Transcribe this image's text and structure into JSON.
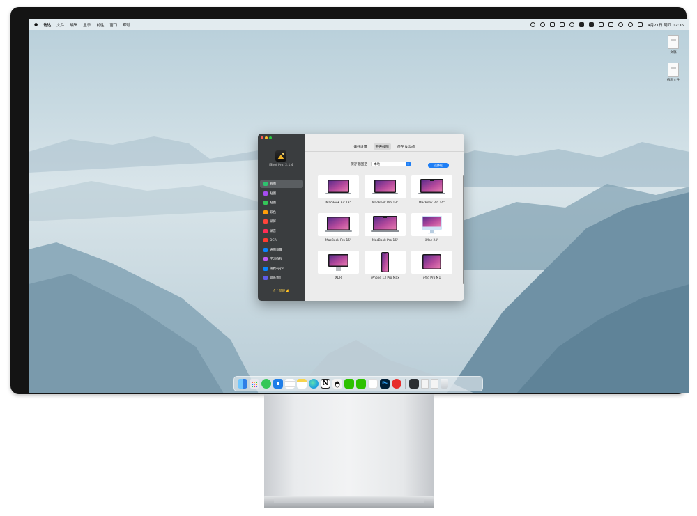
{
  "menubar": {
    "app_name": "访达",
    "menus": [
      "文件",
      "编辑",
      "显示",
      "前往",
      "窗口",
      "帮助"
    ],
    "datetime": "4月21日 周四 02:36"
  },
  "desktop_files": [
    "文稿",
    "截图文件"
  ],
  "app": {
    "version": "iShot Pro: 2.1.4",
    "nav": [
      {
        "label": "截图",
        "color": "#2ec36f",
        "active": true
      },
      {
        "label": "贴图",
        "color": "#a64df2"
      },
      {
        "label": "贴图",
        "color": "#34c759"
      },
      {
        "label": "取色",
        "color": "#ff9f0a"
      },
      {
        "label": "录屏",
        "color": "#ff453a"
      },
      {
        "label": "录音",
        "color": "#ff2d55"
      },
      {
        "label": "OCR",
        "color": "#ff3b30"
      },
      {
        "label": "通用设置",
        "color": "#0a84ff"
      },
      {
        "label": "学习教程",
        "color": "#bf5af2"
      },
      {
        "label": "免费Apps",
        "color": "#0a84ff"
      },
      {
        "label": "联系我们",
        "color": "#5e5ce6"
      }
    ],
    "like_text": "点个赞吧 👍",
    "tabs": [
      "偏好设置",
      "带壳截图",
      "保存 & 动作"
    ],
    "selected_tab": 1,
    "save_label": "保存截图至",
    "save_value": "本地",
    "choose_button": "选择框",
    "devices": [
      "MacBook Air 13\"",
      "MacBook Pro 13\"",
      "MacBook Pro 14\"",
      "MacBook Pro 15\"",
      "MacBook Pro 16\"",
      "iMac 24\"",
      "XDR",
      "iPhone 13 Pro Max",
      "iPad Pro M1"
    ]
  },
  "dock": {
    "apps": [
      {
        "name": "finder-icon",
        "color": "#3a95f5"
      },
      {
        "name": "launchpad-icon",
        "color": "#e9e9ee"
      },
      {
        "name": "messages-icon",
        "color": "#36c759"
      },
      {
        "name": "safari-icon",
        "color": "#1f7ee8"
      },
      {
        "name": "reminders-icon",
        "color": "#ffffff"
      },
      {
        "name": "notes-icon",
        "color": "#f7d44c"
      },
      {
        "name": "edge-icon",
        "color": "#1b9de2"
      },
      {
        "name": "notion-icon",
        "color": "#ffffff"
      },
      {
        "name": "qq-icon",
        "color": "#f3f3f3"
      },
      {
        "name": "wechat-icon",
        "color": "#2dc100"
      },
      {
        "name": "wechat-work-icon",
        "color": "#2dc100"
      },
      {
        "name": "feishu-icon",
        "color": "#ffffff"
      },
      {
        "name": "photoshop-icon",
        "color": "#001e36"
      },
      {
        "name": "netease-music-icon",
        "color": "#e72d2c"
      }
    ],
    "docs": [
      {
        "name": "ishot-dock-icon",
        "color": "#2b2f33"
      },
      {
        "name": "document-icon",
        "color": "#f4f4f4"
      },
      {
        "name": "document-icon",
        "color": "#f4f4f4"
      },
      {
        "name": "trash-icon",
        "color": "#d9dde1"
      }
    ]
  }
}
